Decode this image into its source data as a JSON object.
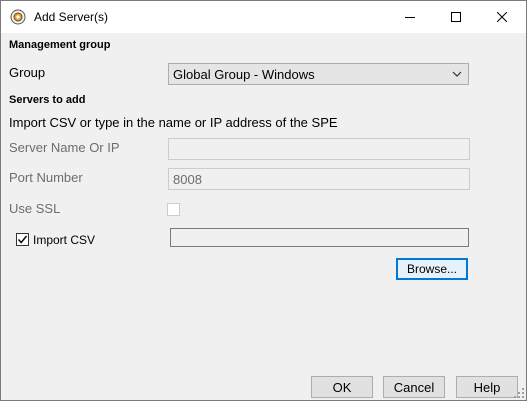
{
  "window": {
    "title": "Add Server(s)",
    "icon": "app-gear-icon",
    "controls": {
      "minimize": "minimize-icon",
      "maximize": "maximize-icon",
      "close": "close-icon"
    }
  },
  "management": {
    "heading": "Management group",
    "group_label": "Group",
    "group_selected": "Global Group - Windows"
  },
  "servers": {
    "heading": "Servers to add",
    "instruction": "Import CSV or type in the name or IP address of the SPE",
    "server_name_label": "Server Name Or IP",
    "server_name_value": "",
    "port_label": "Port Number",
    "port_value": "8008",
    "ssl_label": "Use SSL",
    "ssl_checked": false,
    "import_csv_label": "Import CSV",
    "import_csv_checked": true,
    "csv_path_value": "",
    "browse_label": "Browse..."
  },
  "footer": {
    "ok_label": "OK",
    "cancel_label": "Cancel",
    "help_label": "Help"
  },
  "colors": {
    "focus_border": "#0078d7",
    "disabled_text": "#6d6d6d",
    "dialog_background": "#f0f0f0"
  }
}
